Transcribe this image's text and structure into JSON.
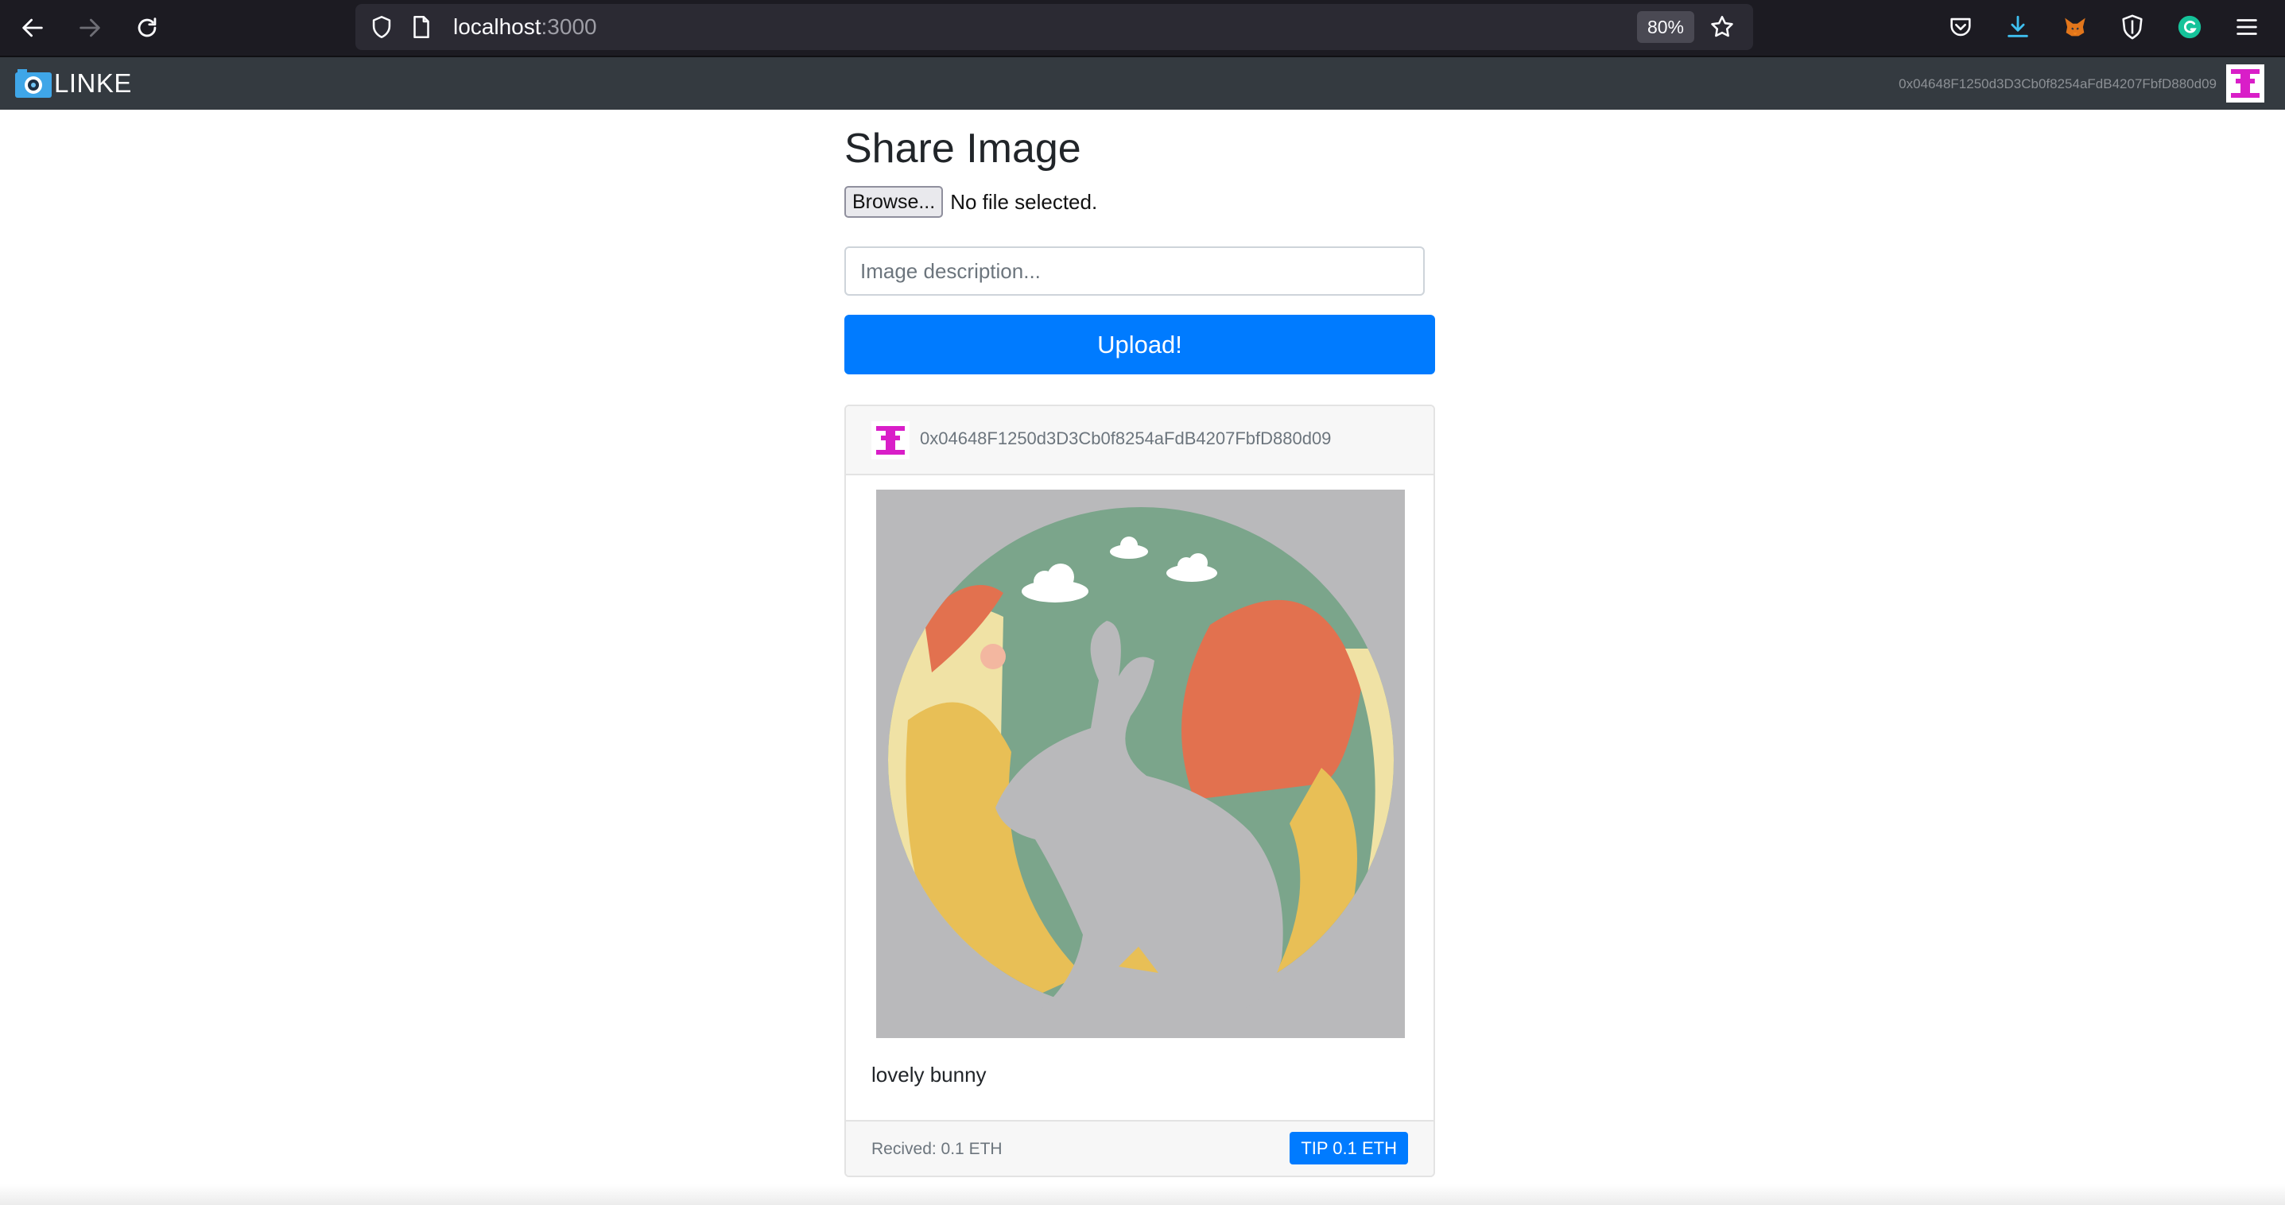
{
  "browser": {
    "url_host": "localhost",
    "url_port": ":3000",
    "zoom": "80%"
  },
  "app": {
    "brand": "LINKE",
    "account_address": "0x04648F1250d3D3Cb0f8254aFdB4207FbfD880d09"
  },
  "form": {
    "title": "Share Image",
    "browse_label": "Browse...",
    "file_status": "No file selected.",
    "description_placeholder": "Image description...",
    "upload_label": "Upload!"
  },
  "post": {
    "author": "0x04648F1250d3D3Cb0f8254aFdB4207FbfD880d09",
    "caption": "lovely bunny",
    "received": "Recived: 0.1 ETH",
    "tip_label": "TIP 0.1 ETH"
  },
  "colors": {
    "primary": "#007bff",
    "navbar": "#343a40",
    "identicon": "#d91ec8"
  },
  "icons": [
    "back-arrow-icon",
    "forward-arrow-icon",
    "reload-icon",
    "shield-icon",
    "page-icon",
    "star-icon",
    "pocket-icon",
    "download-icon",
    "metamask-fox-icon",
    "brave-shield-icon",
    "grammarly-icon",
    "menu-icon",
    "camera-icon",
    "identicon-avatar"
  ]
}
